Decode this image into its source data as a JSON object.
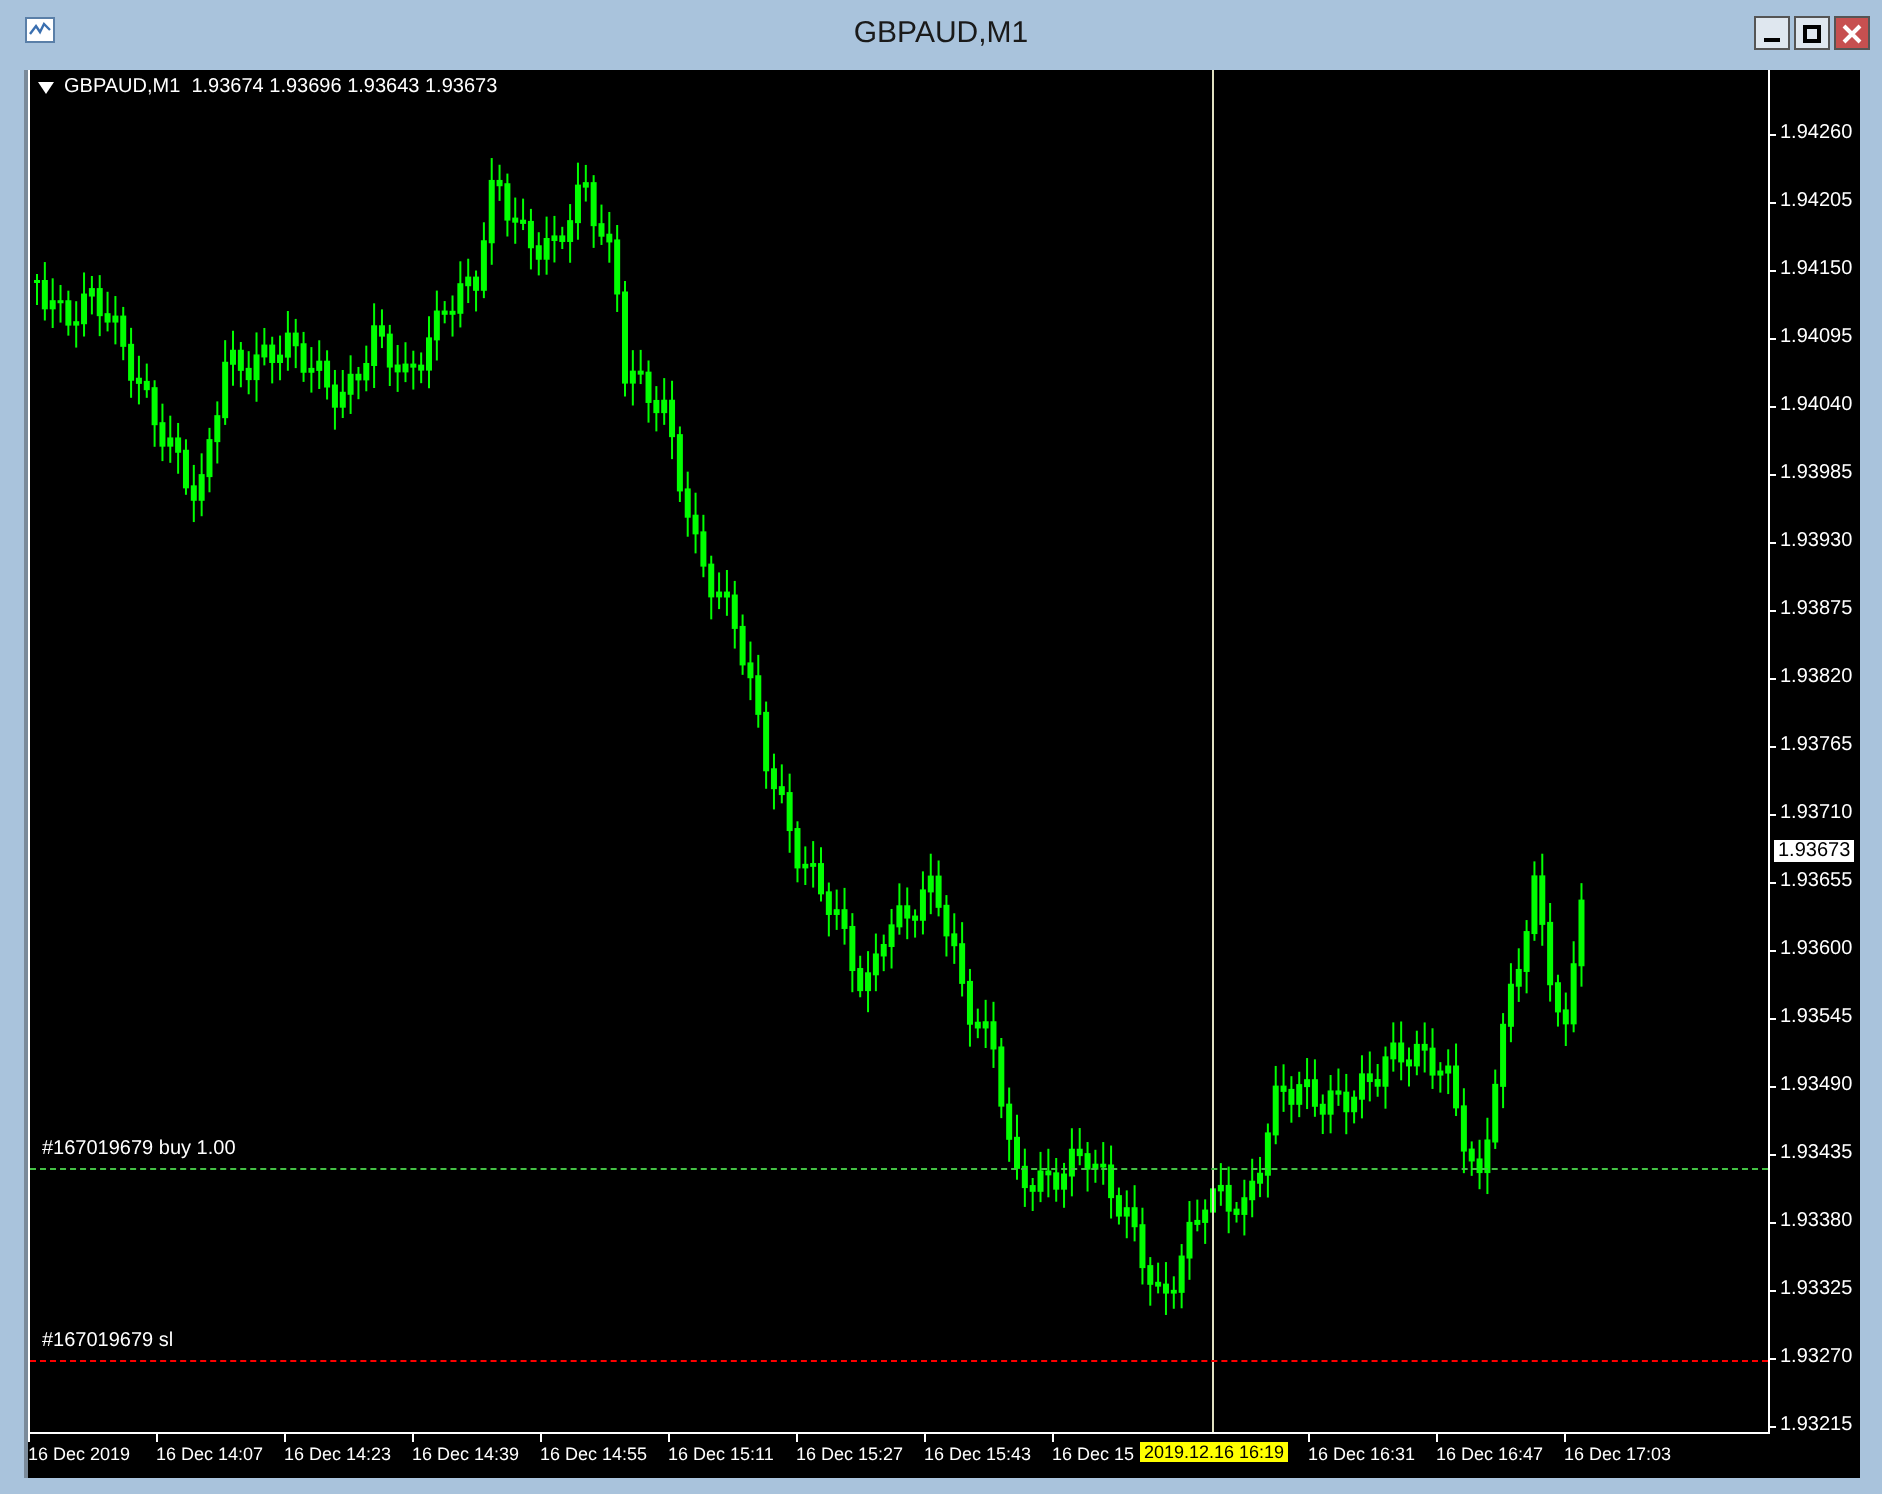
{
  "window": {
    "title": "GBPAUD,M1"
  },
  "chart": {
    "header": "GBPAUD,M1  1.93674 1.93696 1.93643 1.93673",
    "price_axis": [
      "1.94260",
      "1.94205",
      "1.94150",
      "1.94095",
      "1.94040",
      "1.93985",
      "1.93930",
      "1.93875",
      "1.93820",
      "1.93765",
      "1.93710",
      "1.93655",
      "1.93600",
      "1.93545",
      "1.93490",
      "1.93435",
      "1.93380",
      "1.93325",
      "1.93270",
      "1.93215"
    ],
    "current_price": "1.93673",
    "time_axis": [
      "16 Dec 2019",
      "16 Dec 14:07",
      "16 Dec 14:23",
      "16 Dec 14:39",
      "16 Dec 14:55",
      "16 Dec 15:11",
      "16 Dec 15:27",
      "16 Dec 15:43",
      "16 Dec 15",
      "16 Dec 16:31",
      "16 Dec 16:47",
      "16 Dec 17:03"
    ],
    "crosshair_time": "2019.12.16 16:19",
    "order_lines": [
      {
        "kind": "buy",
        "label": "#167019679 buy 1.00"
      },
      {
        "kind": "sl",
        "label": "#167019679 sl"
      }
    ]
  }
}
